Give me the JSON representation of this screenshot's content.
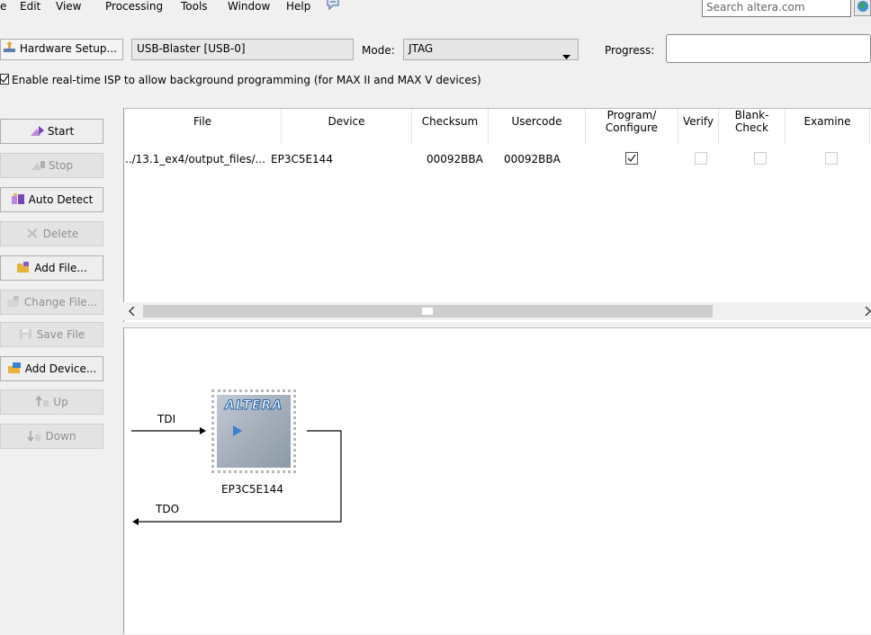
{
  "menu": {
    "items": [
      "e",
      "Edit",
      "View",
      "Processing",
      "Tools",
      "Window",
      "Help"
    ]
  },
  "search": {
    "placeholder": "Search altera.com"
  },
  "toolbar": {
    "hardware_setup_label": "Hardware Setup...",
    "hardware_value": "USB-Blaster [USB-0]",
    "mode_label": "Mode:",
    "mode_value": "JTAG",
    "progress_label": "Progress:"
  },
  "isp": {
    "label": "Enable real-time ISP to allow background programming (for MAX II and MAX V devices)",
    "checked": true
  },
  "side_buttons": [
    {
      "label": "Start",
      "enabled": true,
      "icon": "start-icon"
    },
    {
      "label": "Stop",
      "enabled": false,
      "icon": "stop-icon"
    },
    {
      "label": "Auto Detect",
      "enabled": true,
      "icon": "auto-detect-icon"
    },
    {
      "label": "Delete",
      "enabled": false,
      "icon": "delete-icon"
    },
    {
      "label": "Add File...",
      "enabled": true,
      "icon": "add-file-icon"
    },
    {
      "label": "Change File...",
      "enabled": false,
      "icon": "change-file-icon"
    },
    {
      "label": "Save File",
      "enabled": false,
      "icon": "save-file-icon"
    },
    {
      "label": "Add Device...",
      "enabled": true,
      "icon": "add-device-icon"
    },
    {
      "label": "Up",
      "enabled": false,
      "icon": "up-icon"
    },
    {
      "label": "Down",
      "enabled": false,
      "icon": "down-icon"
    }
  ],
  "table": {
    "headers": [
      "File",
      "Device",
      "Checksum",
      "Usercode",
      "Program/\nConfigure",
      "Verify",
      "Blank-\nCheck",
      "Examine"
    ],
    "rows": [
      {
        "file": "../13.1_ex4/output_files/...",
        "device": "EP3C5E144",
        "checksum": "00092BBA",
        "usercode": "00092BBA",
        "program_configure": true,
        "verify": false,
        "blank_check": false,
        "examine": false
      }
    ]
  },
  "diagram": {
    "tdi_label": "TDI",
    "tdo_label": "TDO",
    "chip_logo": "ALTERA",
    "device_name": "EP3C5E144"
  },
  "colors": {
    "chip_body": "#9aa6b4",
    "chip_logo": "#1f5fa6",
    "pin_border": "#b8b8b8"
  }
}
